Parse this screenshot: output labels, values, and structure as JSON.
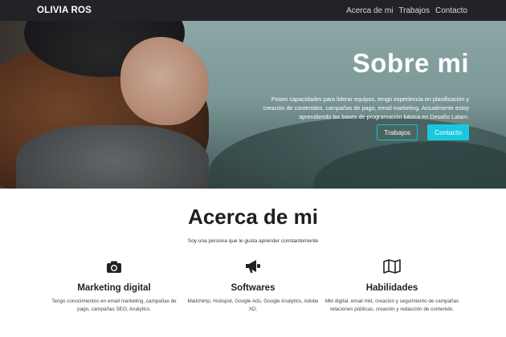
{
  "nav": {
    "brand": "OLIVIA ROS",
    "links": [
      "Acerca de mi",
      "Trabajos",
      "Contacto"
    ]
  },
  "hero": {
    "title": "Sobre mi",
    "description": "Poseo capacidades para liderar equipos, tengo experiencia en planificación y creación de contenidos, campañas de pago, email marketing. Actualmente estoy aprendiendo las bases de programación básica en Desafío Latam.",
    "button_outline": "Trabajos",
    "button_primary": "Contacto"
  },
  "about": {
    "title": "Acerca de mi",
    "subtitle": "Soy una persona que le gusta aprender constantemente",
    "features": [
      {
        "icon": "camera-icon",
        "title": "Marketing digital",
        "text": "Tengo conocimientos en email marketing, campañas de pago, campañas SEO, Analytics."
      },
      {
        "icon": "megaphone-icon",
        "title": "Softwares",
        "text": "Mailchimp, Hubspot, Google Ads, Google Analytics, Adobe XD."
      },
      {
        "icon": "map-icon",
        "title": "Habilidades",
        "text": "Mkt digital, email mkt, creación y seguimiento de campañas relaciones públicas, creación y redacción de contenido."
      }
    ]
  },
  "colors": {
    "navbar": "#222326",
    "accent": "#19c7de"
  }
}
